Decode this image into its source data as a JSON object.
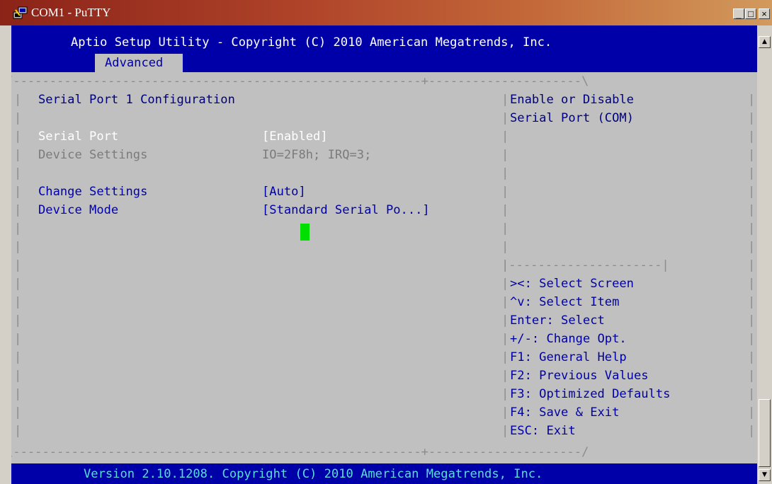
{
  "window": {
    "title": "COM1 - PuTTY",
    "buttons": {
      "minimize": "_",
      "maximize": "□",
      "close": "×"
    }
  },
  "bios": {
    "header_title": "Aptio Setup Utility - Copyright (C) 2010 American Megatrends, Inc.",
    "active_tab": "Advanced",
    "frame": {
      "top": "/--------------------------------------------------------+---------------------\\",
      "bottom": "\\--------------------------------------------------------+---------------------/",
      "help_divider": "|---------------------|"
    },
    "section_title": "Serial Port 1 Configuration",
    "settings": [
      {
        "label": "Serial Port",
        "value": "[Enabled]"
      },
      {
        "label": "Device Settings",
        "value": "IO=2F8h; IRQ=3;"
      },
      {
        "label": "Change Settings",
        "value": "[Auto]"
      },
      {
        "label": "Device Mode",
        "value": "[Standard Serial Po...]"
      }
    ],
    "help_text": [
      "Enable or Disable",
      "Serial Port (COM)"
    ],
    "key_help": [
      "><: Select Screen",
      "^v: Select Item",
      "Enter: Select",
      "+/-: Change Opt.",
      "F1: General Help",
      "F2: Previous Values",
      "F3: Optimized Defaults",
      "F4: Save & Exit",
      "ESC: Exit"
    ],
    "footer": "Version 2.10.1208. Copyright (C) 2010 American Megatrends, Inc."
  },
  "colors": {
    "bios_blue": "#0000a8",
    "bios_gray": "#c0c0c0",
    "cursor_green": "#00e000",
    "title_bar": "#8b2318"
  }
}
